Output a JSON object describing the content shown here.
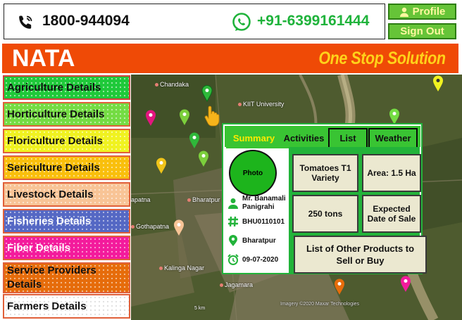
{
  "header": {
    "phone_icon": "phone-icon",
    "phone": "1800-944094",
    "whatsapp_icon": "whatsapp-icon",
    "whatsapp": "+91-6399161444",
    "profile_label": "Profile",
    "signout_label": "Sign Out"
  },
  "banner": {
    "brand": "NATA",
    "tagline": "One Stop Solution"
  },
  "sidebar": {
    "items": [
      {
        "label": "Agriculture Details",
        "color": "#1fc93a"
      },
      {
        "label": "Horticulture Details",
        "color": "#74dc43"
      },
      {
        "label": "Floriculture Details",
        "color": "#f0f220"
      },
      {
        "label": "Sericulture Details",
        "color": "#f9bf0c"
      },
      {
        "label": "Livestock Details",
        "color": "#f8c496"
      },
      {
        "label": "Fisheries Details",
        "color": "#5568c4"
      },
      {
        "label": "Fiber Details",
        "color": "#f31b9c"
      },
      {
        "label": "Service Providers Details",
        "color": "#e66c0b"
      },
      {
        "label": "Farmers Details",
        "color": "#ffffff"
      }
    ]
  },
  "map": {
    "places": [
      "Chandaka",
      "KIIT University",
      "apatna",
      "Bharatpur",
      "Gothapatna",
      "Kalinga Nagar",
      "Jagamara"
    ],
    "scale": "5 km",
    "attribution": "Imagery ©2020 Maxar Technologies"
  },
  "panel": {
    "tabs": [
      "Summary",
      "Activities",
      "List",
      "Weather"
    ],
    "photo_label": "Photo",
    "farmer_name": "Mr. Banamali Panigrahi",
    "farmer_id": "BHU0110101",
    "location": "Bharatpur",
    "date": "09-07-2020",
    "crop": "Tomatoes T1 Variety",
    "area": "Area: 1.5 Ha",
    "quantity": "250 tons",
    "sale_date": "Expected Date of Sale",
    "other_products": "List of Other Products to Sell or Buy"
  },
  "colors": {
    "accent_green": "#22b33a",
    "banner_orange": "#ef4a06",
    "tagline_yellow": "#ffd21a"
  }
}
